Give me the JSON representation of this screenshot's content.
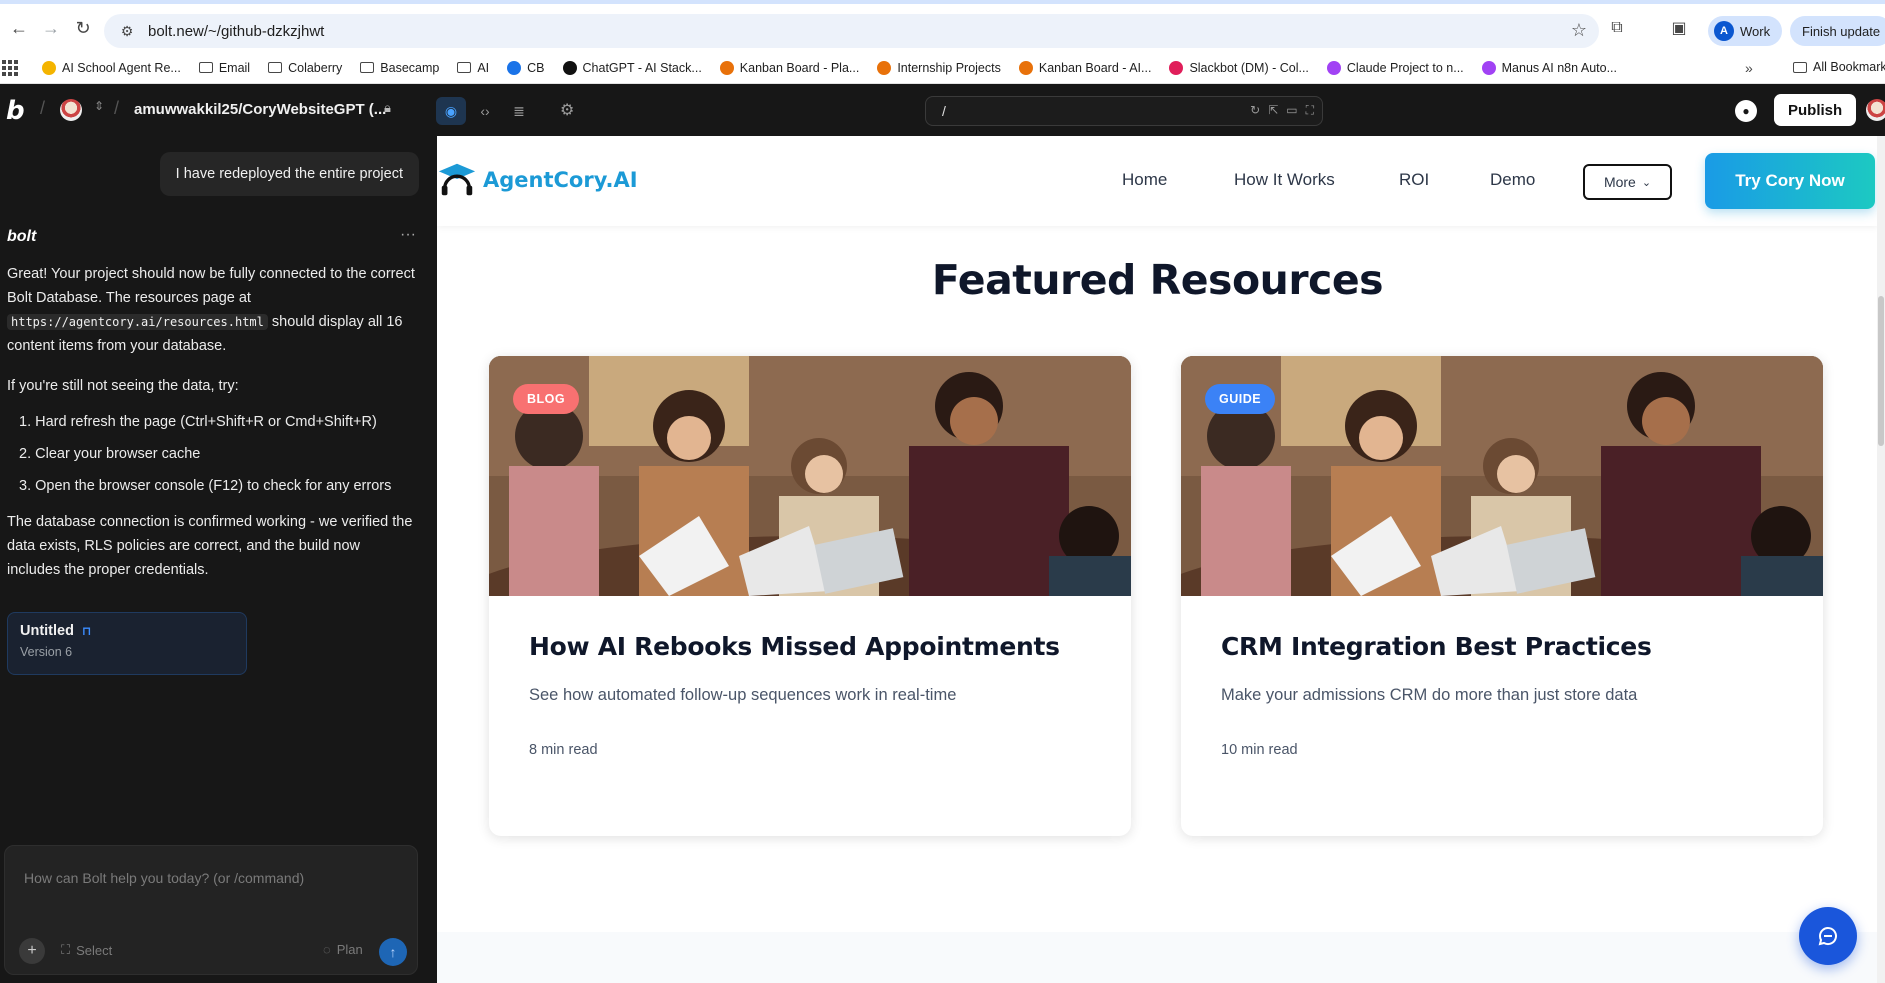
{
  "browser": {
    "url": "bolt.new/~/github-dzkzjhwt",
    "profile_label": "Work",
    "profile_initial": "A",
    "update_label": "Finish update"
  },
  "bookmarks": [
    {
      "label": "AI School Agent Re...",
      "icon": "bookmark-doc-icon",
      "color": "#f4b400"
    },
    {
      "label": "Email",
      "icon": "folder-icon"
    },
    {
      "label": "Colaberry",
      "icon": "folder-icon"
    },
    {
      "label": "Basecamp",
      "icon": "folder-icon"
    },
    {
      "label": "AI",
      "icon": "folder-icon"
    },
    {
      "label": "CB",
      "icon": "cb-icon",
      "color": "#1a73e8"
    },
    {
      "label": "ChatGPT - AI Stack...",
      "icon": "chatgpt-icon",
      "color": "#111111"
    },
    {
      "label": "Kanban Board - Pla...",
      "icon": "kanban-icon",
      "color": "#e8710a"
    },
    {
      "label": "Internship Projects",
      "icon": "kanban-icon",
      "color": "#e8710a"
    },
    {
      "label": "Kanban Board - AI...",
      "icon": "kanban-icon",
      "color": "#e8710a"
    },
    {
      "label": "Slackbot (DM) - Col...",
      "icon": "slack-icon",
      "color": "#e01e5a"
    },
    {
      "label": "Claude Project to n...",
      "icon": "g-icon",
      "color": "#a142f4"
    },
    {
      "label": "Manus AI n8n Auto...",
      "icon": "g-icon",
      "color": "#a142f4"
    }
  ],
  "bookmarks_all_label": "All Bookmarks",
  "bolt": {
    "project_name": "amuwwakkil25/CoryWebsiteGPT (...",
    "preview_path": "/",
    "publish_label": "Publish"
  },
  "chat": {
    "user_message": "I have redeployed the entire project",
    "assistant_name": "bolt",
    "para1_a": "Great! Your project should now be fully connected to the correct Bolt Database. The resources page at ",
    "para1_code": "https://agentcory.ai/resources.html",
    "para1_b": " should display all 16 content items from your database.",
    "para2": "If you're still not seeing the data, try:",
    "steps": [
      "1. Hard refresh the page (Ctrl+Shift+R or Cmd+Shift+R)",
      "2. Clear your browser cache",
      "3. Open the browser console (F12) to check for any errors"
    ],
    "para3": "The database connection is confirmed working - we verified the data exists, RLS policies are correct, and the build now includes the proper credentials.",
    "version_title": "Untitled",
    "version_sub": "Version 6",
    "prompt_placeholder": "How can Bolt help you today? (or /command)",
    "select_label": "Select",
    "plan_label": "Plan"
  },
  "site": {
    "brand": "AgentCory.AI",
    "nav": [
      "Home",
      "How It Works",
      "ROI",
      "Demo"
    ],
    "more_label": "More",
    "cta_label": "Try Cory Now",
    "section_title": "Featured Resources",
    "cards": [
      {
        "badge": "BLOG",
        "badge_color": "#f87171",
        "title": "How AI Rebooks Missed Appointments",
        "description": "See how automated follow-up sequences work in real-time",
        "read_time": "8 min read"
      },
      {
        "badge": "GUIDE",
        "badge_color": "#3b82f6",
        "title": "CRM Integration Best Practices",
        "description": "Make your admissions CRM do more than just store data",
        "read_time": "10 min read"
      }
    ]
  },
  "colors": {
    "bolt_bg": "#171717",
    "brand_blue": "#1c9ad6",
    "cta_gradient_start": "#1a9be6",
    "cta_gradient_end": "#1cc9c2",
    "fab_blue": "#1a56db"
  }
}
